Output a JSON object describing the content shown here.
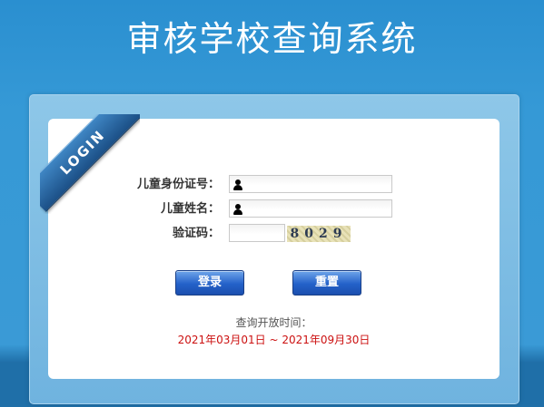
{
  "page": {
    "title": "审核学校查询系统"
  },
  "ribbon": {
    "text": "LOGIN"
  },
  "form": {
    "id_label": "儿童身份证号：",
    "id_value": "",
    "name_label": "儿童姓名：",
    "name_value": "",
    "captcha_label": "验证码：",
    "captcha_value": "",
    "captcha_code": "8029"
  },
  "buttons": {
    "login": "登录",
    "reset": "重置"
  },
  "query": {
    "label": "查询开放时间：",
    "period": "2021年03月01日 ~ 2021年09月30日"
  },
  "icons": [
    "user-icon"
  ],
  "colors": {
    "button": "#2461c9",
    "period_text": "#cc1111",
    "background": "#3599d6"
  }
}
